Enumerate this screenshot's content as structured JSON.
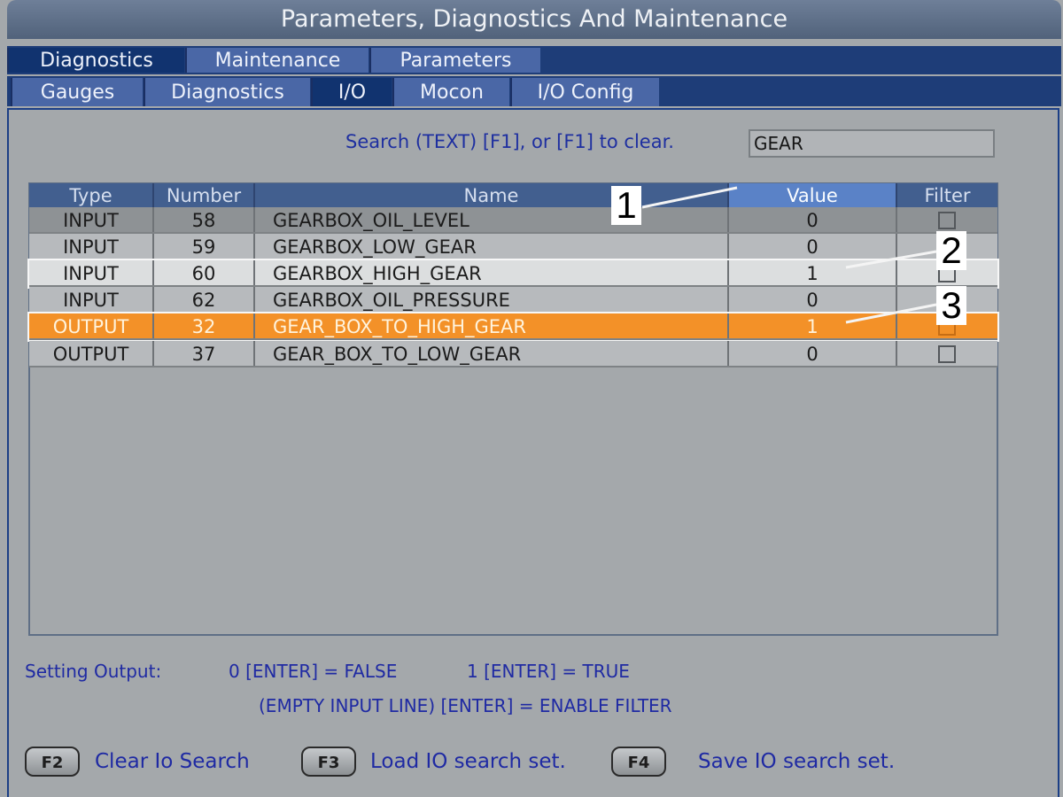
{
  "window": {
    "title": "Parameters, Diagnostics And Maintenance"
  },
  "tabs_level1": [
    {
      "label": "Diagnostics",
      "active": true
    },
    {
      "label": "Maintenance",
      "active": false
    },
    {
      "label": "Parameters",
      "active": false
    }
  ],
  "tabs_level2": [
    {
      "label": "Gauges",
      "active": false
    },
    {
      "label": "Diagnostics",
      "active": false
    },
    {
      "label": "I/O",
      "active": true
    },
    {
      "label": "Mocon",
      "active": false
    },
    {
      "label": "I/O Config",
      "active": false
    }
  ],
  "search": {
    "label": "Search (TEXT) [F1], or [F1] to clear.",
    "value": "GEAR"
  },
  "table": {
    "headers": [
      "Type",
      "Number",
      "Name",
      "Value",
      "Filter"
    ],
    "rows": [
      {
        "type": "INPUT",
        "number": "58",
        "name": "GEARBOX_OIL_LEVEL",
        "value": "0",
        "filter": false,
        "style": "dark"
      },
      {
        "type": "INPUT",
        "number": "59",
        "name": "GEARBOX_LOW_GEAR",
        "value": "0",
        "filter": false,
        "style": "normal"
      },
      {
        "type": "INPUT",
        "number": "60",
        "name": "GEARBOX_HIGH_GEAR",
        "value": "1",
        "filter": false,
        "style": "highlight"
      },
      {
        "type": "INPUT",
        "number": "62",
        "name": "GEARBOX_OIL_PRESSURE",
        "value": "0",
        "filter": false,
        "style": "normal"
      },
      {
        "type": "OUTPUT",
        "number": "32",
        "name": "GEAR_BOX_TO_HIGH_GEAR",
        "value": "1",
        "filter": false,
        "style": "selected"
      },
      {
        "type": "OUTPUT",
        "number": "37",
        "name": "GEAR_BOX_TO_LOW_GEAR",
        "value": "0",
        "filter": false,
        "style": "normal"
      }
    ]
  },
  "callouts": [
    "1",
    "2",
    "3"
  ],
  "footer": {
    "setting_output_label": "Setting Output:",
    "false_text": "0 [ENTER] = FALSE",
    "true_text": "1 [ENTER] = TRUE",
    "filter_text": "(EMPTY INPUT LINE) [ENTER] = ENABLE FILTER"
  },
  "function_keys": [
    {
      "key": "F2",
      "label": "Clear Io Search"
    },
    {
      "key": "F3",
      "label": "Load IO search set."
    },
    {
      "key": "F4",
      "label": "Save IO search set."
    }
  ],
  "colors": {
    "accent_orange": "#f39128",
    "header_blue": "#425f8f",
    "tab_blue": "#4a67a6",
    "text_blue": "#1f2aa3"
  }
}
